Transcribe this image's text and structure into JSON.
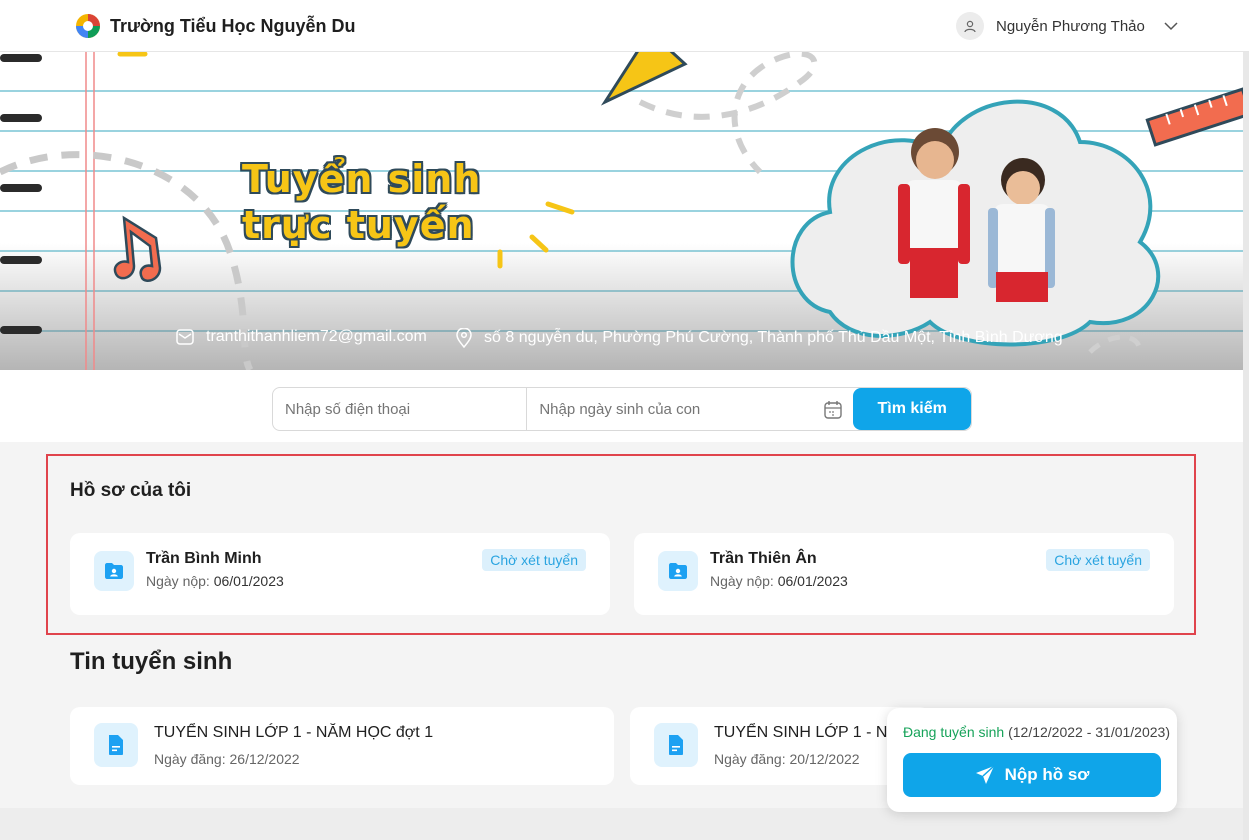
{
  "header": {
    "school_name": "Trường Tiểu Học Nguyễn Du",
    "user_name": "Nguyễn Phương Thảo"
  },
  "banner": {
    "title_line1": "Tuyển sinh",
    "title_line2": "trực tuyến",
    "email": "tranthithanhliem72@gmail.com",
    "address": "số 8 nguyễn du, Phường Phú Cường, Thành phố Thủ Dầu Một, Tỉnh Bình Dương"
  },
  "search": {
    "phone_placeholder": "Nhập số điện thoại",
    "dob_placeholder": "Nhập ngày sinh của con",
    "button_label": "Tìm kiếm"
  },
  "profiles": {
    "title": "Hồ sơ của tôi",
    "date_label": "Ngày nộp:",
    "items": [
      {
        "name": "Trần Bình Minh",
        "date": "06/01/2023",
        "status": "Chờ xét tuyển"
      },
      {
        "name": "Trần Thiên Ân",
        "date": "06/01/2023",
        "status": "Chờ xét tuyển"
      }
    ]
  },
  "news": {
    "title": "Tin tuyển sinh",
    "date_label": "Ngày đăng:",
    "items": [
      {
        "name": "TUYỂN SINH LỚP 1 - NĂM HỌC đợt 1",
        "date": "26/12/2022"
      },
      {
        "name": "TUYỂN SINH LỚP 1 - NĂM HỌC",
        "date": "20/12/2022"
      }
    ]
  },
  "float_panel": {
    "status": "Đang tuyển sinh",
    "range": "(12/12/2022 - 31/01/2023)",
    "button_label": "Nộp hồ sơ"
  },
  "colors": {
    "primary": "#0fa5e9",
    "badge_text": "#2aa4e0",
    "highlight_border": "#e0434c",
    "status_green": "#17a35a",
    "title_yellow": "#f6c516"
  }
}
